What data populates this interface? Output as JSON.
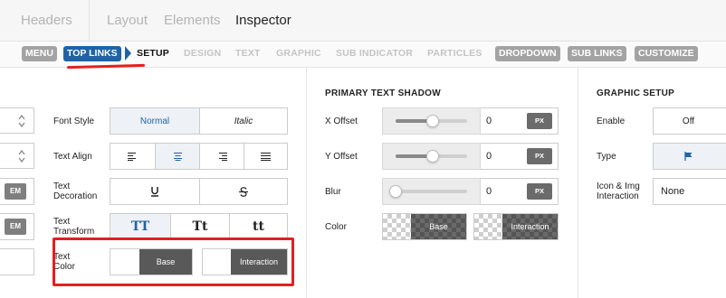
{
  "top_tabs": [
    "Headers",
    "Layout",
    "Elements",
    "Inspector"
  ],
  "sub_nav": {
    "menu": "MENU",
    "top_links": "TOP LINKS",
    "setup": "SETUP",
    "design": "DESIGN",
    "text": "TEXT",
    "graphic": "GRAPHIC",
    "sub_indicator": "SUB INDICATOR",
    "particles": "PARTICLES",
    "dropdown": "DROPDOWN",
    "sub_links": "SUB LINKS",
    "customize": "CUSTOMIZE"
  },
  "left_col": {
    "em1": "EM",
    "em2": "EM"
  },
  "text_col": {
    "font_style": "Font Style",
    "font_style_normal": "Normal",
    "font_style_italic": "Italic",
    "text_align": "Text Align",
    "text_decoration": "Text Decoration",
    "text_transform": "Text Transform",
    "tt_upper": "TT",
    "tt_cap": "Tt",
    "tt_lower": "tt",
    "text_color": "Text Color",
    "base": "Base",
    "interaction": "Interaction"
  },
  "shadow_col": {
    "title": "PRIMARY TEXT SHADOW",
    "x_offset": "X Offset",
    "y_offset": "Y Offset",
    "blur": "Blur",
    "color": "Color",
    "x_value": "0",
    "y_value": "0",
    "blur_value": "0",
    "unit": "PX",
    "base": "Base",
    "interaction": "Interaction",
    "x_slider_level": 0.5,
    "y_slider_level": 0.5,
    "blur_slider_level": 0.0
  },
  "graphic_col": {
    "title": "GRAPHIC SETUP",
    "enable": "Enable",
    "enable_value": "Off",
    "type": "Type",
    "icon_img_interaction": "Icon & Img Interaction",
    "interaction_value": "None"
  },
  "colors": {
    "accent_blue": "#1f63a6",
    "annotation_red": "#e41f1f"
  }
}
